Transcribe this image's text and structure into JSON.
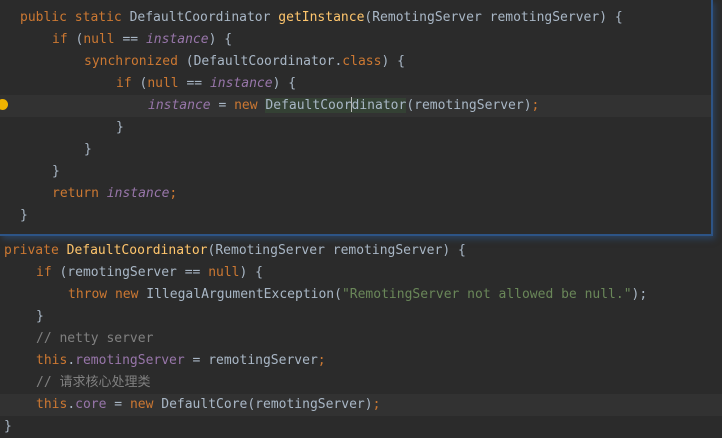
{
  "colors": {
    "background": "#2b2b2b",
    "keyword": "#cc7832",
    "field": "#9876aa",
    "method": "#ffc66d",
    "string": "#6a8759",
    "comment": "#808080",
    "popup_border": "#2d5486"
  },
  "popup": {
    "lines": [
      {
        "indent": 0,
        "tokens": [
          [
            "public static ",
            "kw"
          ],
          [
            "DefaultCoordinator ",
            "txt"
          ],
          [
            "getInstance",
            "mth"
          ],
          [
            "(RemotingServer remotingServer) {",
            "txt"
          ]
        ]
      },
      {
        "indent": 1,
        "tokens": [
          [
            "if ",
            "kw"
          ],
          [
            "(",
            "txt"
          ],
          [
            "null ",
            "kw"
          ],
          [
            "== ",
            "txt"
          ],
          [
            "instance",
            "fld"
          ],
          [
            ") {",
            "txt"
          ]
        ]
      },
      {
        "indent": 2,
        "tokens": [
          [
            "synchronized ",
            "kw"
          ],
          [
            "(DefaultCoordinator.",
            "txt"
          ],
          [
            "class",
            "kw"
          ],
          [
            ") {",
            "txt"
          ]
        ]
      },
      {
        "indent": 3,
        "tokens": [
          [
            "if ",
            "kw"
          ],
          [
            "(",
            "txt"
          ],
          [
            "null ",
            "kw"
          ],
          [
            "== ",
            "txt"
          ],
          [
            "instance",
            "fld"
          ],
          [
            ") {",
            "txt"
          ]
        ]
      },
      {
        "indent": 4,
        "current": true,
        "bulb": true,
        "tokens": [
          [
            "instance",
            "fld"
          ],
          [
            " = ",
            "txt"
          ],
          [
            "new ",
            "kw"
          ],
          [
            "DefaultCoor",
            "hl"
          ],
          [
            "dinator",
            "hl"
          ],
          [
            "(remotingServer)",
            "txt"
          ],
          [
            ";",
            "kw"
          ]
        ]
      },
      {
        "indent": 3,
        "tokens": [
          [
            "}",
            "txt"
          ]
        ]
      },
      {
        "indent": 2,
        "tokens": [
          [
            "}",
            "txt"
          ]
        ]
      },
      {
        "indent": 1,
        "tokens": [
          [
            "}",
            "txt"
          ]
        ]
      },
      {
        "indent": 1,
        "tokens": [
          [
            "return ",
            "kw"
          ],
          [
            "instance",
            "fld"
          ],
          [
            ";",
            "kw"
          ]
        ]
      },
      {
        "indent": 0,
        "tokens": [
          [
            "}",
            "txt"
          ]
        ]
      }
    ]
  },
  "editor": {
    "lines": [
      {
        "indent": 0,
        "tokens": [
          [
            "private ",
            "kw"
          ],
          [
            "DefaultCoordinator",
            "mth"
          ],
          [
            "(RemotingServer remotingServer) {",
            "txt"
          ]
        ]
      },
      {
        "indent": 1,
        "tokens": [
          [
            "if ",
            "kw"
          ],
          [
            "(remotingServer == ",
            "txt"
          ],
          [
            "null",
            "kw"
          ],
          [
            ") {",
            "txt"
          ]
        ]
      },
      {
        "indent": 2,
        "tokens": [
          [
            "throw new ",
            "kw"
          ],
          [
            "IllegalArgumentException(",
            "txt"
          ],
          [
            "\"RemotingServer not allowed be null.\"",
            "str"
          ],
          [
            ");",
            "txt"
          ]
        ]
      },
      {
        "indent": 1,
        "tokens": [
          [
            "}",
            "txt"
          ]
        ]
      },
      {
        "indent": 1,
        "tokens": [
          [
            "// netty server",
            "cmt"
          ]
        ]
      },
      {
        "indent": 1,
        "tokens": [
          [
            "this",
            "kw"
          ],
          [
            ".",
            "txt"
          ],
          [
            "remotingServer",
            "fldn"
          ],
          [
            " = remotingServer",
            "txt"
          ],
          [
            ";",
            "kw"
          ]
        ]
      },
      {
        "indent": 1,
        "tokens": [
          [
            "// 请求核心处理类",
            "cmt"
          ]
        ]
      },
      {
        "indent": 1,
        "current": true,
        "tokens": [
          [
            "this",
            "kw"
          ],
          [
            ".",
            "txt"
          ],
          [
            "core",
            "fldn"
          ],
          [
            " = ",
            "txt"
          ],
          [
            "new ",
            "kw"
          ],
          [
            "DefaultCore(remotingServer)",
            "txt"
          ],
          [
            ";",
            "kw"
          ]
        ]
      },
      {
        "indent": 0,
        "tokens": [
          [
            "}",
            "txt"
          ]
        ]
      }
    ]
  }
}
